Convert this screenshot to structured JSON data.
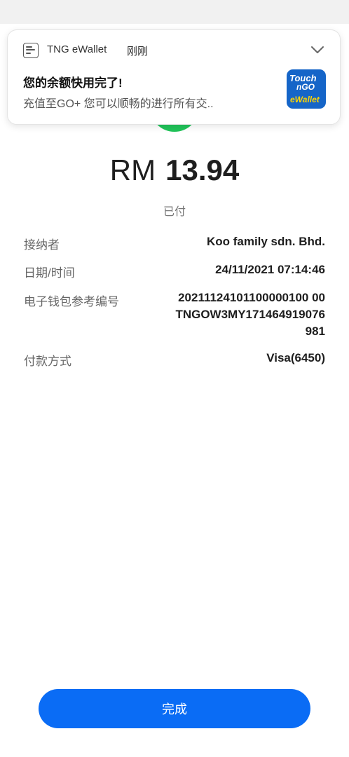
{
  "notification": {
    "app_name": "TNG eWallet",
    "time": "刚刚",
    "title": "您的余额快用完了!",
    "body": "充值至GO+ 您可以顺畅的进行所有交..",
    "logo_line1": "Touch",
    "logo_line2": "nGO",
    "logo_line3": "eWallet"
  },
  "receipt": {
    "currency": "RM",
    "amount": "13.94",
    "status": "已付",
    "details": [
      {
        "label": "接纳者",
        "value": "Koo family sdn. Bhd."
      },
      {
        "label": "日期/时间",
        "value": "24/11/2021 07:14:46"
      },
      {
        "label": "电子钱包参考编号",
        "value": "20211124101100000100 00TNGOW3MY171464919076981"
      },
      {
        "label": "付款方式",
        "value": "Visa(6450)"
      }
    ]
  },
  "actions": {
    "done_label": "完成"
  },
  "colors": {
    "accent": "#0a6cf5",
    "success": "#21c45a",
    "brand": "#1565c8"
  },
  "icons": {
    "app": "tng-app-icon",
    "expand": "chevron-down-icon",
    "logo": "touch-n-go-logo",
    "status": "success-check-icon"
  }
}
